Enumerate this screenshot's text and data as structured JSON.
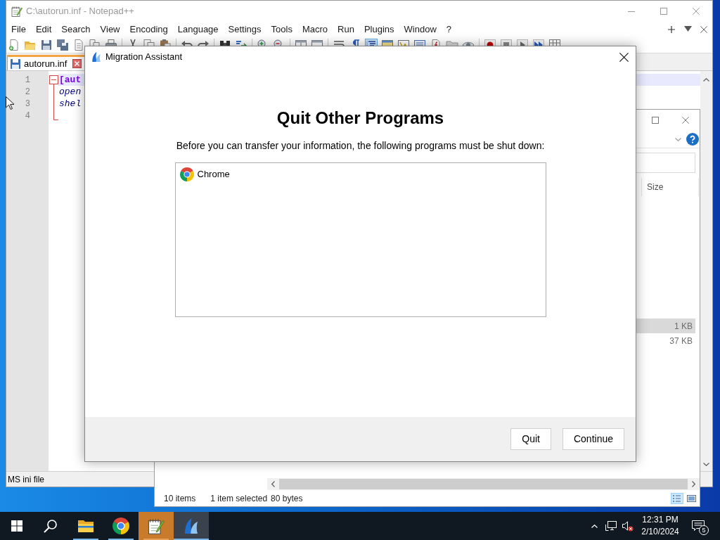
{
  "notepad": {
    "title": "C:\\autorun.inf - Notepad++",
    "active": false,
    "menu": [
      "File",
      "Edit",
      "Search",
      "View",
      "Encoding",
      "Language",
      "Settings",
      "Tools",
      "Macro",
      "Run",
      "Plugins",
      "Window",
      "?"
    ],
    "toolbar": [
      [
        {
          "kind": "new",
          "on": false
        },
        {
          "kind": "open",
          "on": false
        },
        {
          "kind": "save",
          "on": false
        },
        {
          "kind": "save-all",
          "on": false
        },
        {
          "kind": "close",
          "on": false
        },
        {
          "kind": "close-all",
          "on": false
        },
        {
          "kind": "print",
          "on": false
        }
      ],
      [
        {
          "kind": "cut",
          "on": false
        },
        {
          "kind": "copy",
          "on": false
        },
        {
          "kind": "paste",
          "on": false
        }
      ],
      [
        {
          "kind": "undo",
          "on": false
        },
        {
          "kind": "redo",
          "on": false
        }
      ],
      [
        {
          "kind": "find",
          "on": false
        },
        {
          "kind": "replace",
          "on": false
        }
      ],
      [
        {
          "kind": "zoom-in",
          "on": false
        },
        {
          "kind": "zoom-out",
          "on": false
        }
      ],
      [
        {
          "kind": "sync-v",
          "on": false
        },
        {
          "kind": "sync-h",
          "on": false
        }
      ],
      [
        {
          "kind": "wrap",
          "on": false
        },
        {
          "kind": "all-chars",
          "on": false
        },
        {
          "kind": "indent-guide",
          "on": true
        },
        {
          "kind": "udl",
          "on": false
        },
        {
          "kind": "doc-map",
          "on": false
        },
        {
          "kind": "doc-list",
          "on": false
        },
        {
          "kind": "function-list",
          "on": false
        },
        {
          "kind": "folder-workspace",
          "on": false
        },
        {
          "kind": "monitoring",
          "on": false
        }
      ],
      [
        {
          "kind": "record",
          "on": false
        },
        {
          "kind": "stop",
          "on": false
        },
        {
          "kind": "play",
          "on": false
        },
        {
          "kind": "play-multi",
          "on": false
        },
        {
          "kind": "save-macro",
          "on": false
        }
      ]
    ],
    "tabs": [
      {
        "label": "autorun.inf",
        "selected": true
      }
    ],
    "lines": [
      {
        "number": "1",
        "kind": "section",
        "text": "[aut",
        "current": true
      },
      {
        "number": "2",
        "kind": "key",
        "text": "open",
        "current": false
      },
      {
        "number": "3",
        "kind": "key",
        "text": "shel",
        "current": false
      },
      {
        "number": "4",
        "current": false
      }
    ],
    "status_bar": "MS ini file"
  },
  "explorer": {
    "columns": [
      "Size"
    ],
    "rows": [
      {
        "size": "1 KB",
        "selected": true
      },
      {
        "size": "37 KB",
        "selected": false
      }
    ],
    "status": {
      "count": "10 items",
      "selection": "1 item selected",
      "selection_size": "80 bytes"
    },
    "view_buttons": [
      {
        "kind": "details",
        "selected": true
      },
      {
        "kind": "large-icons",
        "selected": false
      }
    ]
  },
  "dialog": {
    "title": "Migration Assistant",
    "heading": "Quit Other Programs",
    "message": "Before you can transfer your information, the following programs must be shut down:",
    "programs": [
      "Chrome"
    ],
    "buttons": [
      "Quit",
      "Continue"
    ]
  },
  "taskbar": {
    "apps": [
      {
        "kind": "file-explorer",
        "running": true,
        "flashing": false,
        "active": false
      },
      {
        "kind": "chrome",
        "running": true,
        "flashing": false,
        "active": false
      },
      {
        "kind": "notepad",
        "running": true,
        "flashing": true,
        "active": false
      },
      {
        "kind": "migration-assistant",
        "running": true,
        "flashing": false,
        "active": true
      }
    ],
    "time": "12:31 PM",
    "date": "2/10/2024",
    "notification_count": "5"
  }
}
